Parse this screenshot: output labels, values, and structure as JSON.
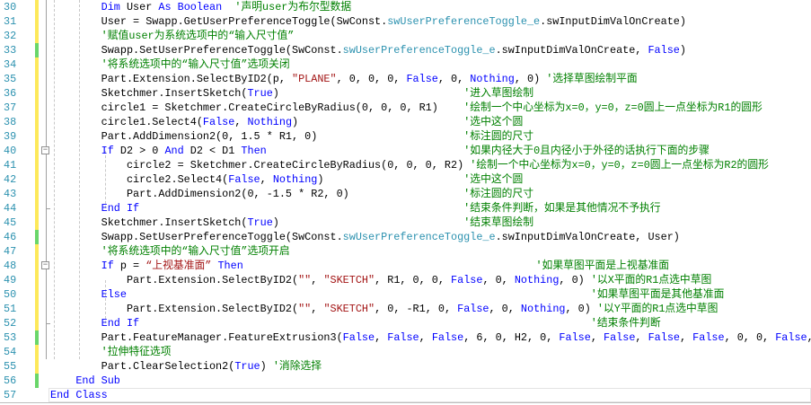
{
  "colors": {
    "keyword": "#0000ff",
    "string": "#a31515",
    "type": "#2b91af",
    "comment": "#008000",
    "line_number": "#2b91af",
    "changed_saved": "#6ad66a",
    "changed_unsaved": "#fde95a"
  },
  "lines": [
    {
      "num": "30",
      "mark": "y",
      "tokens": [
        {
          "c": "p",
          "t": "        "
        },
        {
          "c": "k",
          "t": "Dim"
        },
        {
          "c": "p",
          "t": " User "
        },
        {
          "c": "k",
          "t": "As"
        },
        {
          "c": "p",
          "t": " "
        },
        {
          "c": "k",
          "t": "Boolean"
        },
        {
          "c": "c",
          "t": "  '声明user为布尔型数据"
        }
      ]
    },
    {
      "num": "31",
      "mark": "y",
      "tokens": [
        {
          "c": "p",
          "t": "        User = Swapp.GetUserPreferenceToggle(SwConst."
        },
        {
          "c": "t",
          "t": "swUserPreferenceToggle_e"
        },
        {
          "c": "p",
          "t": ".swInputDimValOnCreate)"
        }
      ]
    },
    {
      "num": "32",
      "mark": "y",
      "tokens": [
        {
          "c": "p",
          "t": "        "
        },
        {
          "c": "c",
          "t": "'赋值user为系统选项中的“输入尺寸值”"
        }
      ]
    },
    {
      "num": "33",
      "mark": "g",
      "tokens": [
        {
          "c": "p",
          "t": "        Swapp.SetUserPreferenceToggle(SwConst."
        },
        {
          "c": "t",
          "t": "swUserPreferenceToggle_e"
        },
        {
          "c": "p",
          "t": ".swInputDimValOnCreate, "
        },
        {
          "c": "k",
          "t": "False"
        },
        {
          "c": "p",
          "t": ")"
        }
      ]
    },
    {
      "num": "34",
      "mark": "y",
      "tokens": [
        {
          "c": "p",
          "t": "        "
        },
        {
          "c": "c",
          "t": "'将系统选项中的“输入尺寸值”选项关闭"
        }
      ]
    },
    {
      "num": "35",
      "mark": "y",
      "tokens": [
        {
          "c": "p",
          "t": "        Part.Extension.SelectByID2(p, "
        },
        {
          "c": "s",
          "t": "\"PLANE\""
        },
        {
          "c": "p",
          "t": ", 0, 0, 0, "
        },
        {
          "c": "k",
          "t": "False"
        },
        {
          "c": "p",
          "t": ", 0, "
        },
        {
          "c": "k",
          "t": "Nothing"
        },
        {
          "c": "p",
          "t": ", 0) "
        },
        {
          "c": "c",
          "t": "'选择草图绘制平面"
        }
      ]
    },
    {
      "num": "36",
      "mark": "y",
      "tokens": [
        {
          "c": "p",
          "t": "        Sketchmer.InsertSketch("
        },
        {
          "c": "k",
          "t": "True"
        },
        {
          "c": "p",
          "t": ")                             "
        },
        {
          "c": "c",
          "t": "'进入草图绘制"
        }
      ]
    },
    {
      "num": "37",
      "mark": "y",
      "tokens": [
        {
          "c": "p",
          "t": "        circle1 = Sketchmer.CreateCircleByRadius(0, 0, 0, R1)    "
        },
        {
          "c": "c",
          "t": "'绘制一个中心坐标为x=0，y=0，z=0圆上一点坐标为R1的圆形"
        }
      ]
    },
    {
      "num": "38",
      "mark": "y",
      "tokens": [
        {
          "c": "p",
          "t": "        circle1.Select4("
        },
        {
          "c": "k",
          "t": "False"
        },
        {
          "c": "p",
          "t": ", "
        },
        {
          "c": "k",
          "t": "Nothing"
        },
        {
          "c": "p",
          "t": ")                          "
        },
        {
          "c": "c",
          "t": "'选中这个圆"
        }
      ]
    },
    {
      "num": "39",
      "mark": "y",
      "tokens": [
        {
          "c": "p",
          "t": "        Part.AddDimension2(0, 1.5 * R1, 0)                       "
        },
        {
          "c": "c",
          "t": "'标注圆的尺寸"
        }
      ]
    },
    {
      "num": "40",
      "mark": "y",
      "tokens": [
        {
          "c": "p",
          "t": "        "
        },
        {
          "c": "k",
          "t": "If"
        },
        {
          "c": "p",
          "t": " D2 > 0 "
        },
        {
          "c": "k",
          "t": "And"
        },
        {
          "c": "p",
          "t": " D2 < D1 "
        },
        {
          "c": "k",
          "t": "Then"
        },
        {
          "c": "p",
          "t": "                               "
        },
        {
          "c": "c",
          "t": "'如果内径大于0且内径小于外径的话执行下面的步骤"
        }
      ]
    },
    {
      "num": "41",
      "mark": "y",
      "tokens": [
        {
          "c": "p",
          "t": "            circle2 = Sketchmer.CreateCircleByRadius(0, 0, 0, R2) "
        },
        {
          "c": "c",
          "t": "'绘制一个中心坐标为x=0，y=0，z=0圆上一点坐标为R2的圆形"
        }
      ]
    },
    {
      "num": "42",
      "mark": "y",
      "tokens": [
        {
          "c": "p",
          "t": "            circle2.Select4("
        },
        {
          "c": "k",
          "t": "False"
        },
        {
          "c": "p",
          "t": ", "
        },
        {
          "c": "k",
          "t": "Nothing"
        },
        {
          "c": "p",
          "t": ")                      "
        },
        {
          "c": "c",
          "t": "'选中这个圆"
        }
      ]
    },
    {
      "num": "43",
      "mark": "y",
      "tokens": [
        {
          "c": "p",
          "t": "            Part.AddDimension2(0, -1.5 * R2, 0)                  "
        },
        {
          "c": "c",
          "t": "'标注圆的尺寸"
        }
      ]
    },
    {
      "num": "44",
      "mark": "y",
      "tokens": [
        {
          "c": "p",
          "t": "        "
        },
        {
          "c": "k",
          "t": "End If"
        },
        {
          "c": "p",
          "t": "                                                   "
        },
        {
          "c": "c",
          "t": "'结束条件判断，如果是其他情况不予执行"
        }
      ]
    },
    {
      "num": "45",
      "mark": "y",
      "tokens": [
        {
          "c": "p",
          "t": "        Sketchmer.InsertSketch("
        },
        {
          "c": "k",
          "t": "True"
        },
        {
          "c": "p",
          "t": ")                             "
        },
        {
          "c": "c",
          "t": "'结束草图绘制"
        }
      ]
    },
    {
      "num": "46",
      "mark": "g",
      "tokens": [
        {
          "c": "p",
          "t": "        Swapp.SetUserPreferenceToggle(SwConst."
        },
        {
          "c": "t",
          "t": "swUserPreferenceToggle_e"
        },
        {
          "c": "p",
          "t": ".swInputDimValOnCreate, User)"
        }
      ]
    },
    {
      "num": "47",
      "mark": "y",
      "tokens": [
        {
          "c": "p",
          "t": "        "
        },
        {
          "c": "c",
          "t": "'将系统选项中的“输入尺寸值”选项开启"
        }
      ]
    },
    {
      "num": "48",
      "mark": "y",
      "tokens": [
        {
          "c": "p",
          "t": "        "
        },
        {
          "c": "k",
          "t": "If"
        },
        {
          "c": "p",
          "t": " p = "
        },
        {
          "c": "s",
          "t": "“上视基准面”"
        },
        {
          "c": "p",
          "t": " "
        },
        {
          "c": "k",
          "t": "Then"
        },
        {
          "c": "p",
          "t": "                                              "
        },
        {
          "c": "c",
          "t": "'如果草图平面是上视基准面"
        }
      ]
    },
    {
      "num": "49",
      "mark": "y",
      "tokens": [
        {
          "c": "p",
          "t": "            Part.Extension.SelectByID2("
        },
        {
          "c": "s",
          "t": "\"\""
        },
        {
          "c": "p",
          "t": ", "
        },
        {
          "c": "s",
          "t": "\"SKETCH\""
        },
        {
          "c": "p",
          "t": ", R1, 0, 0, "
        },
        {
          "c": "k",
          "t": "False"
        },
        {
          "c": "p",
          "t": ", 0, "
        },
        {
          "c": "k",
          "t": "Nothing"
        },
        {
          "c": "p",
          "t": ", 0) "
        },
        {
          "c": "c",
          "t": "'以X平面的R1点选中草图"
        }
      ]
    },
    {
      "num": "50",
      "mark": "y",
      "tokens": [
        {
          "c": "p",
          "t": "        "
        },
        {
          "c": "k",
          "t": "Else"
        },
        {
          "c": "p",
          "t": "                                                                         "
        },
        {
          "c": "c",
          "t": "'如果草图平面是其他基准面"
        }
      ]
    },
    {
      "num": "51",
      "mark": "y",
      "tokens": [
        {
          "c": "p",
          "t": "            Part.Extension.SelectByID2("
        },
        {
          "c": "s",
          "t": "\"\""
        },
        {
          "c": "p",
          "t": ", "
        },
        {
          "c": "s",
          "t": "\"SKETCH\""
        },
        {
          "c": "p",
          "t": ", 0, -R1, 0, "
        },
        {
          "c": "k",
          "t": "False"
        },
        {
          "c": "p",
          "t": ", 0, "
        },
        {
          "c": "k",
          "t": "Nothing"
        },
        {
          "c": "p",
          "t": ", 0) "
        },
        {
          "c": "c",
          "t": "'以Y平面的R1点选中草图"
        }
      ]
    },
    {
      "num": "52",
      "mark": "y",
      "tokens": [
        {
          "c": "p",
          "t": "        "
        },
        {
          "c": "k",
          "t": "End If"
        },
        {
          "c": "p",
          "t": "                                                                       "
        },
        {
          "c": "c",
          "t": "'结束条件判断"
        }
      ]
    },
    {
      "num": "53",
      "mark": "g",
      "tokens": [
        {
          "c": "p",
          "t": "        Part.FeatureManager.FeatureExtrusion3("
        },
        {
          "c": "k",
          "t": "False"
        },
        {
          "c": "p",
          "t": ", "
        },
        {
          "c": "k",
          "t": "False"
        },
        {
          "c": "p",
          "t": ", "
        },
        {
          "c": "k",
          "t": "False"
        },
        {
          "c": "p",
          "t": ", 6, 0, H2, 0, "
        },
        {
          "c": "k",
          "t": "False"
        },
        {
          "c": "p",
          "t": ", "
        },
        {
          "c": "k",
          "t": "False"
        },
        {
          "c": "p",
          "t": ", "
        },
        {
          "c": "k",
          "t": "False"
        },
        {
          "c": "p",
          "t": ", "
        },
        {
          "c": "k",
          "t": "False"
        },
        {
          "c": "p",
          "t": ", 0, 0, "
        },
        {
          "c": "k",
          "t": "False"
        },
        {
          "c": "p",
          "t": ","
        }
      ]
    },
    {
      "num": "54",
      "mark": "y",
      "tokens": [
        {
          "c": "p",
          "t": "        "
        },
        {
          "c": "c",
          "t": "'拉伸特征选项"
        }
      ]
    },
    {
      "num": "55",
      "mark": "y",
      "tokens": [
        {
          "c": "p",
          "t": "        Part.ClearSelection2("
        },
        {
          "c": "k",
          "t": "True"
        },
        {
          "c": "p",
          "t": ") "
        },
        {
          "c": "c",
          "t": "'消除选择"
        }
      ]
    },
    {
      "num": "56",
      "mark": "g",
      "tokens": [
        {
          "c": "p",
          "t": "    "
        },
        {
          "c": "k",
          "t": "End Sub"
        }
      ]
    },
    {
      "num": "57",
      "mark": "",
      "tokens": [
        {
          "c": "k",
          "t": "End Class"
        }
      ]
    }
  ]
}
